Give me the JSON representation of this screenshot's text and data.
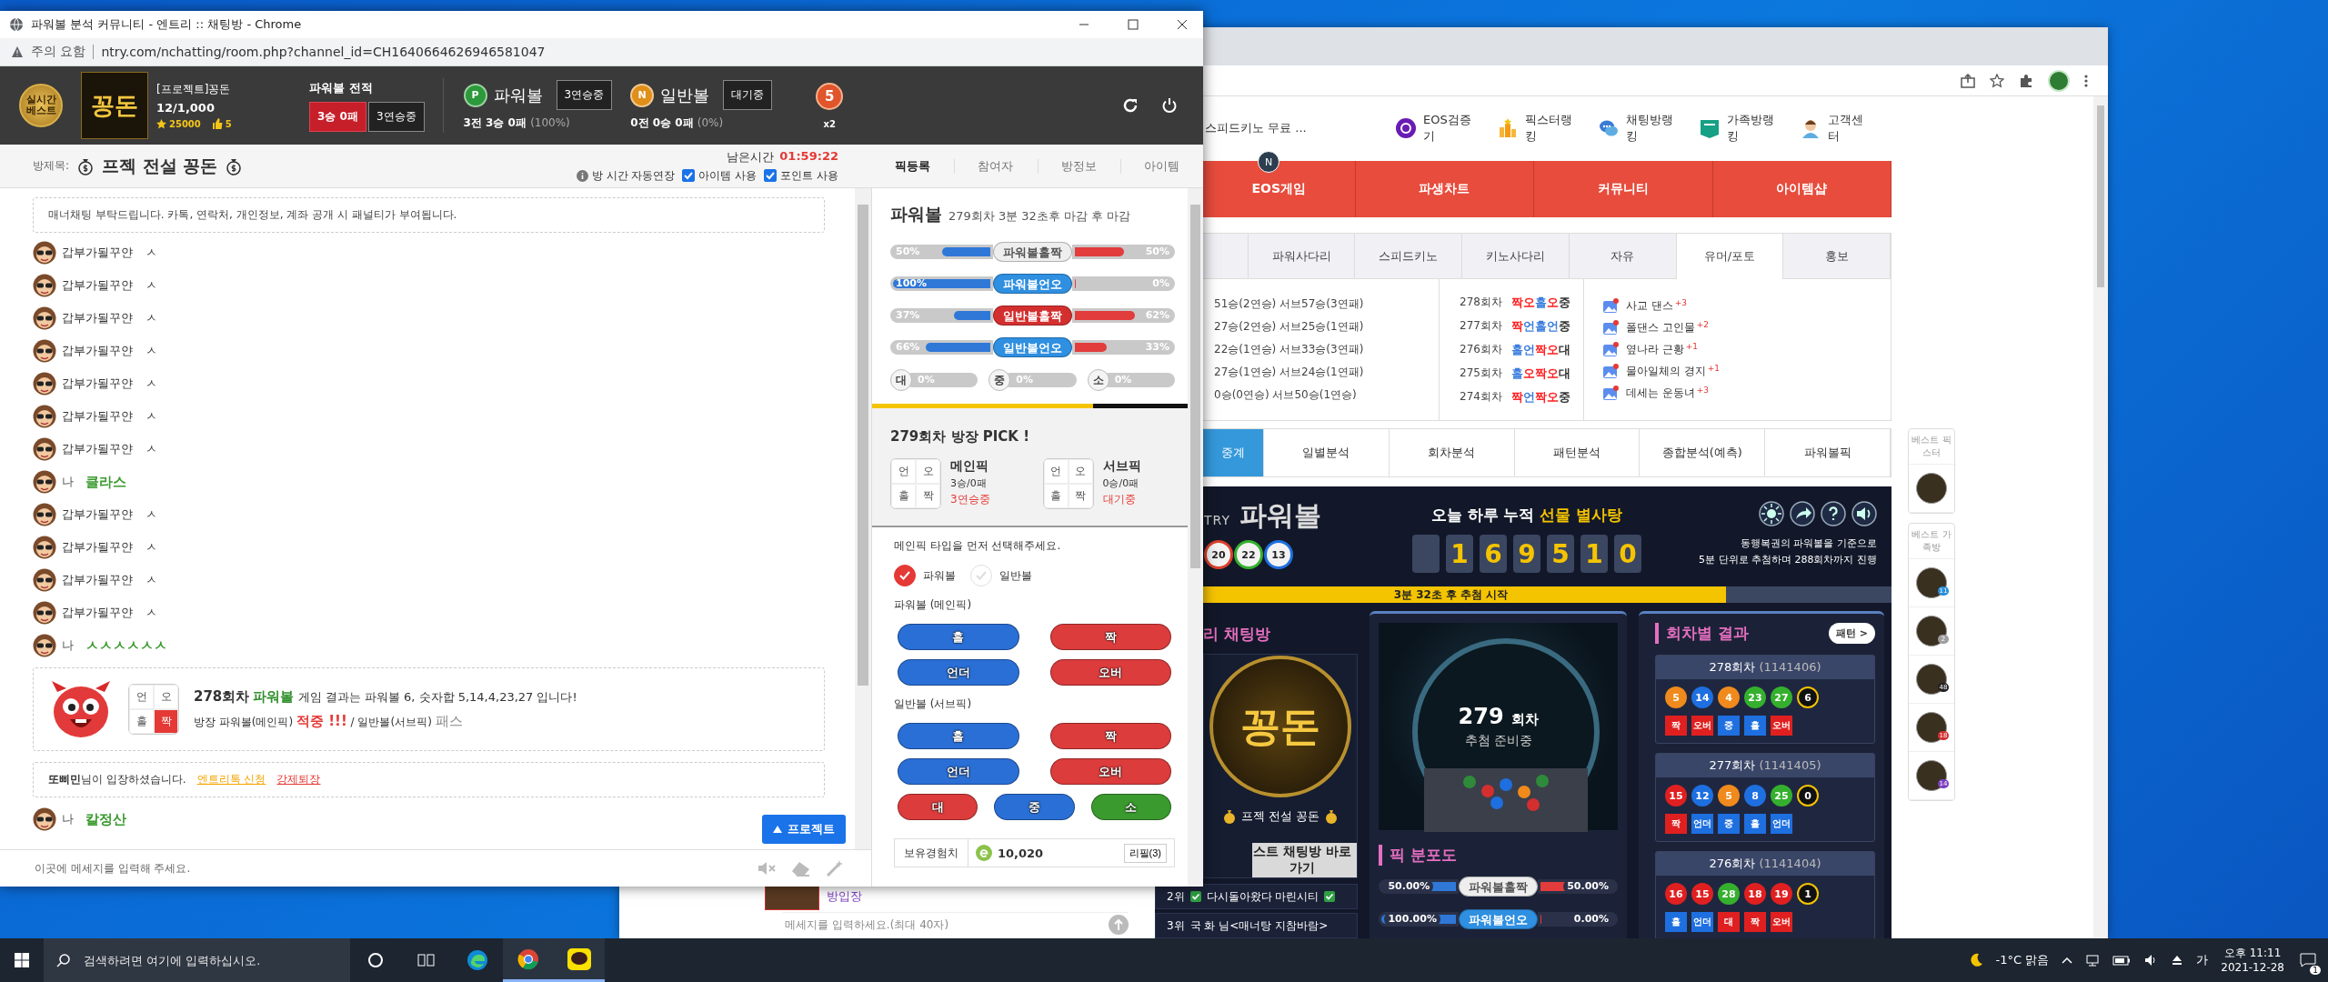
{
  "chat_window": {
    "title": "파워볼 분석 커뮤니티 - 엔트리 :: 채팅방 - Chrome",
    "security_label": "주의 요함",
    "url": "ntry.com/nchatting/room.php?channel_id=CH1640664626946581047",
    "header": {
      "badge": "실시간 베스트",
      "logo": "꽁돈",
      "room_name": "[프로젝트]꽁돈",
      "members": "12/1,000",
      "points": "25000",
      "likes": "5",
      "record_title": "파워볼 전적",
      "record": "3승 0패",
      "record_streak": "3연승중",
      "games": [
        {
          "badge": "P",
          "name": "파워볼",
          "status": "3연승중",
          "stats": "3전 3승 0패",
          "rate": "(100%)"
        },
        {
          "badge": "N",
          "name": "일반볼",
          "status": "대기중",
          "stats": "0전 0승 0패",
          "rate": "(0%)"
        }
      ],
      "medal": "5",
      "multiplier": "x2"
    },
    "room": {
      "label": "방제목:",
      "title": "프젝 전설 꽁돈",
      "time_label": "남은시간",
      "time": "01:59:22",
      "auto_extend": "방 시간 자동연장",
      "options": [
        {
          "label": "아이템 사용",
          "checked": true
        },
        {
          "label": "포인트 사용",
          "checked": true
        }
      ],
      "tabs": [
        {
          "label": "픽등록",
          "selected": true
        },
        {
          "label": "참여자",
          "selected": false
        },
        {
          "label": "방정보",
          "selected": false
        },
        {
          "label": "아이템",
          "selected": false
        }
      ]
    },
    "chat": {
      "notice": "매너채팅 부탁드립니다. 카톡, 연락처, 개인정보, 계좌 공개 시 패널티가 부여됩니다.",
      "messages": [
        {
          "kind": "user",
          "name": "갑부가될꾸얀",
          "text": "ㅅ"
        },
        {
          "kind": "user",
          "name": "갑부가될꾸얀",
          "text": "ㅅ"
        },
        {
          "kind": "user",
          "name": "갑부가될꾸얀",
          "text": "ㅅ"
        },
        {
          "kind": "user",
          "name": "갑부가될꾸얀",
          "text": "ㅅ"
        },
        {
          "kind": "user",
          "name": "갑부가될꾸얀",
          "text": "ㅅ"
        },
        {
          "kind": "user",
          "name": "갑부가될꾸얀",
          "text": "ㅅ"
        },
        {
          "kind": "user",
          "name": "갑부가될꾸얀",
          "text": "ㅅ"
        },
        {
          "kind": "me",
          "name": "나",
          "text": "클라스"
        },
        {
          "kind": "user",
          "name": "갑부가될꾸얀",
          "text": "ㅅ"
        },
        {
          "kind": "user",
          "name": "갑부가될꾸얀",
          "text": "ㅅ"
        },
        {
          "kind": "user",
          "name": "갑부가될꾸얀",
          "text": "ㅅ"
        },
        {
          "kind": "user",
          "name": "갑부가될꾸얀",
          "text": "ㅅ"
        },
        {
          "kind": "me",
          "name": "나",
          "text": "ㅅㅅㅅㅅㅅㅅ"
        },
        {
          "kind": "result",
          "round": "278회차",
          "game": "파워볼",
          "text": "게임 결과는 파워볼 6, 숫자합 5,14,4,23,27 입니다!",
          "cells": [
            {
              "label": "언",
              "selected": false
            },
            {
              "label": "오",
              "selected": false
            },
            {
              "label": "홀",
              "selected": false
            },
            {
              "label": "짝",
              "selected": true
            }
          ],
          "verdict": [
            {
              "kind": "plain",
              "text": "방장 파워볼(메인픽)"
            },
            {
              "kind": "hit",
              "text": "적중 !!!"
            },
            {
              "kind": "plain",
              "text": "/ 일반볼(서브픽)"
            },
            {
              "kind": "pass",
              "text": "패스"
            }
          ]
        },
        {
          "kind": "system",
          "user": "또삐민",
          "text": "님이 입장하셨습니다.",
          "links": [
            {
              "label": "엔트리톡 신청",
              "color": "#f5a300"
            },
            {
              "label": "강제퇴장",
              "color": "#e53935"
            }
          ]
        },
        {
          "kind": "me",
          "name": "나",
          "text": "칼정산"
        }
      ],
      "float_button": "프로젝트",
      "input": {
        "placeholder": "이곳에 메세지를 입력해 주세요."
      }
    },
    "pick_panel": {
      "game": "파워볼",
      "round_info": "279회차 3분 32초후 마감 후 마감",
      "bars": [
        {
          "label": "파워볼홀짝",
          "color": "#eeeeee",
          "left": {
            "text": "50%",
            "level": 0.5
          },
          "right": {
            "text": "50%",
            "level": 0.5
          }
        },
        {
          "label": "파워볼언오",
          "color": "#2f8fe0",
          "left": {
            "text": "100%",
            "level": 1
          },
          "right": {
            "text": "0%",
            "level": 0
          }
        },
        {
          "label": "일반볼홀짝",
          "color": "#d32f2f",
          "left": {
            "text": "37%",
            "level": 0.37
          },
          "right": {
            "text": "62%",
            "level": 0.62
          }
        },
        {
          "label": "일반볼언오",
          "color": "#2f8fe0",
          "left": {
            "text": "66%",
            "level": 0.66
          },
          "right": {
            "text": "33%",
            "level": 0.33
          }
        }
      ],
      "size_bars": [
        {
          "label": "대",
          "text": "0%",
          "level": 0
        },
        {
          "label": "중",
          "text": "0%",
          "level": 0
        },
        {
          "label": "소",
          "text": "0%",
          "level": 0
        }
      ],
      "timer": {
        "level": 0.7
      },
      "pick_title": "279회차 방장 PICK !",
      "picks": [
        {
          "title": "메인픽",
          "record": "3승/0패",
          "status": "3연승중",
          "cells": [
            {
              "label": "언",
              "selected": false
            },
            {
              "label": "오",
              "selected": false
            },
            {
              "label": "홀",
              "selected": false
            },
            {
              "label": "짝",
              "selected": false
            }
          ]
        },
        {
          "title": "서브픽",
          "record": "0승/0패",
          "status": "대기중",
          "cells": [
            {
              "label": "언",
              "selected": false
            },
            {
              "label": "오",
              "selected": false
            },
            {
              "label": "홀",
              "selected": false
            },
            {
              "label": "짝",
              "selected": false
            }
          ]
        }
      ],
      "instruction": "메인픽 타입을 먼저 선택해주세요.",
      "types": [
        {
          "label": "파워볼",
          "selected": true
        },
        {
          "label": "일반볼",
          "selected": false
        }
      ],
      "groups": [
        {
          "title": "파워볼 (메인픽)",
          "buttons": [
            {
              "label": "홀",
              "color": "#2a6fd6"
            },
            {
              "label": "짝",
              "color": "#dc3c3c"
            },
            {
              "label": "언더",
              "color": "#2a6fd6"
            },
            {
              "label": "오버",
              "color": "#dc3c3c"
            }
          ]
        },
        {
          "title": "일반볼 (서브픽)",
          "buttons": [
            {
              "label": "홀",
              "color": "#2a6fd6"
            },
            {
              "label": "짝",
              "color": "#dc3c3c"
            },
            {
              "label": "언더",
              "color": "#2a6fd6"
            },
            {
              "label": "오버",
              "color": "#dc3c3c"
            },
            {
              "label": "대",
              "color": "#dc3c3c"
            },
            {
              "label": "중",
              "color": "#2a6fd6"
            },
            {
              "label": "소",
              "color": "#3a9a2e"
            }
          ]
        }
      ],
      "exp_label": "보유경험치",
      "exp_value": "10,020",
      "refill": "리필(3)"
    }
  },
  "browser": {
    "ticker": "스피드키노 무료 ...",
    "shortcuts": [
      {
        "label": "EOS검증기",
        "kind": "eos"
      },
      {
        "label": "픽스터랭킹",
        "kind": "trophy"
      },
      {
        "label": "채팅방랭킹",
        "kind": "chat"
      },
      {
        "label": "가족방랭킹",
        "kind": "fam"
      },
      {
        "label": "고객센터",
        "kind": "agent"
      }
    ],
    "nav": [
      {
        "label": "EOS게임",
        "badge": "N"
      },
      {
        "label": "파생차트"
      },
      {
        "label": "커뮤니티"
      },
      {
        "label": "아이템샵"
      }
    ],
    "board_tabs": [
      {
        "label": "파워사다리",
        "selected": false
      },
      {
        "label": "스피드키노",
        "selected": false
      },
      {
        "label": "키노사다리",
        "selected": false
      },
      {
        "label": "자유",
        "selected": false
      },
      {
        "label": "유머/포토",
        "selected": true
      },
      {
        "label": "홍보",
        "selected": false
      }
    ],
    "stats": [
      "51승(2연승) 서브57승(3연패)",
      "27승(2연승) 서브25승(1연패)",
      "22승(1연승) 서브33승(3연패)",
      "27승(1연승) 서브24승(1연패)",
      "0승(0연승) 서브50승(1연승)"
    ],
    "results": [
      {
        "round": "278회차",
        "tokens": [
          {
            "text": "짝",
            "color": "#ff2020"
          },
          {
            "text": "오",
            "color": "#ff2020"
          },
          {
            "text": "홀",
            "color": "#3b7ddd"
          },
          {
            "text": "오",
            "color": "#ff2020"
          },
          {
            "text": "중",
            "color": "#333333"
          }
        ]
      },
      {
        "round": "277회차",
        "tokens": [
          {
            "text": "짝",
            "color": "#ff2020"
          },
          {
            "text": "언",
            "color": "#3b7ddd"
          },
          {
            "text": "홀",
            "color": "#3b7ddd"
          },
          {
            "text": "언",
            "color": "#3b7ddd"
          },
          {
            "text": "중",
            "color": "#333333"
          }
        ]
      },
      {
        "round": "276회차",
        "tokens": [
          {
            "text": "홀",
            "color": "#3b7ddd"
          },
          {
            "text": "언",
            "color": "#3b7ddd"
          },
          {
            "text": "짝",
            "color": "#ff2020"
          },
          {
            "text": "오",
            "color": "#ff2020"
          },
          {
            "text": "대",
            "color": "#333333"
          }
        ]
      },
      {
        "round": "275회차",
        "tokens": [
          {
            "text": "홀",
            "color": "#3b7ddd"
          },
          {
            "text": "오",
            "color": "#ff2020"
          },
          {
            "text": "짝",
            "color": "#ff2020"
          },
          {
            "text": "오",
            "color": "#ff2020"
          },
          {
            "text": "대",
            "color": "#333333"
          }
        ]
      },
      {
        "round": "274회차",
        "tokens": [
          {
            "text": "짝",
            "color": "#ff2020"
          },
          {
            "text": "언",
            "color": "#3b7ddd"
          },
          {
            "text": "짝",
            "color": "#ff2020"
          },
          {
            "text": "오",
            "color": "#ff2020"
          },
          {
            "text": "중",
            "color": "#333333"
          }
        ]
      }
    ],
    "posts": [
      {
        "title": "사교 댄스",
        "count": "+3"
      },
      {
        "title": "폴댄스 고인물",
        "count": "+2"
      },
      {
        "title": "옆나라 근황",
        "count": "+1"
      },
      {
        "title": "물아일체의 경지",
        "count": "+1"
      },
      {
        "title": "데세는 운동녀",
        "count": "+3"
      }
    ],
    "analysis_tabs": [
      {
        "label": "중계",
        "selected": true
      },
      {
        "label": "일별분석",
        "selected": false
      },
      {
        "label": "회차분석",
        "selected": false
      },
      {
        "label": "패턴분석",
        "selected": false
      },
      {
        "label": "종합분석(예측)",
        "selected": false
      },
      {
        "label": "파워볼픽",
        "selected": false
      }
    ],
    "side": {
      "pixter_title": "베스트 픽스터",
      "family_title": "베스트 가족방",
      "family": [
        {
          "badge": "11",
          "color": "#2a8fd8"
        },
        {
          "badge": "2",
          "color": "#9e9e9e"
        },
        {
          "badge": "48",
          "color": "#222222"
        },
        {
          "badge": "18",
          "color": "#d32f2f"
        },
        {
          "badge": "14",
          "color": "#7b3fbf"
        }
      ]
    },
    "bottom": {
      "entry_label": "방입장",
      "input_placeholder": "메세지를 입력하세요.(최대 40자)"
    },
    "game": {
      "logo_prefix": "TRY",
      "logo": "파워볼",
      "logo_balls": [
        "20",
        "22",
        "13"
      ],
      "headline": "오늘 하루 누적",
      "headline_highlight": "선물 별사탕",
      "counter": [
        "1",
        "6",
        "9",
        "5",
        "1",
        "0"
      ],
      "info": [
        "동행복권의 파워볼을 기준으로",
        "5분 단위로 추첨하며 288회차까지 진행"
      ],
      "countdown": {
        "text": "3분 32초 후 추첨 시작",
        "level": 0.76
      },
      "chat_title": "리 채팅방",
      "chat_logo": "꽁돈",
      "chat_name": "프젝 전설 꽁돈",
      "best_button": "스트 채팅방 바로가기",
      "ranking": [
        {
          "rank": "2위",
          "name": "다시돌아왔다 마린시티"
        },
        {
          "rank": "3위",
          "name": "국 화 님<매너탕 지참바람>"
        }
      ],
      "machine": {
        "round": "279",
        "round_label": "회차",
        "status": "추첨 준비중"
      },
      "distribution_title": "픽 분포도",
      "distribution": [
        {
          "label": "파워볼홀짝",
          "color": "#eeeeee",
          "left": {
            "text": "50.00%",
            "level": 0.5
          },
          "right": {
            "text": "50.00%",
            "level": 0.5
          }
        },
        {
          "label": "파워볼언오",
          "color": "#2f8fe0",
          "left": {
            "text": "100.00%",
            "level": 1
          },
          "right": {
            "text": "0.00%",
            "level": 0
          }
        }
      ],
      "results_title": "회차별 결과",
      "pattern_button": "패턴 >",
      "rounds": [
        {
          "round": "278회차",
          "id": "(1141406)",
          "balls": [
            {
              "n": "5",
              "color": "#f08a1c"
            },
            {
              "n": "14",
              "color": "#1e6fe0"
            },
            {
              "n": "4",
              "color": "#f08a1c"
            },
            {
              "n": "23",
              "color": "#35b02e"
            },
            {
              "n": "27",
              "color": "#35b02e"
            }
          ],
          "power": "6",
          "tags": [
            {
              "label": "짝",
              "color": "#e02020"
            },
            {
              "label": "오버",
              "color": "#e02020"
            },
            {
              "label": "중",
              "color": "#1e6fe0"
            },
            {
              "label": "홀",
              "color": "#1e6fe0"
            },
            {
              "label": "오버",
              "color": "#e02020"
            }
          ]
        },
        {
          "round": "277회차",
          "id": "(1141405)",
          "balls": [
            {
              "n": "15",
              "color": "#e02020"
            },
            {
              "n": "12",
              "color": "#1e6fe0"
            },
            {
              "n": "5",
              "color": "#f08a1c"
            },
            {
              "n": "8",
              "color": "#1e6fe0"
            },
            {
              "n": "25",
              "color": "#35b02e"
            }
          ],
          "power": "0",
          "tags": [
            {
              "label": "짝",
              "color": "#e02020"
            },
            {
              "label": "언더",
              "color": "#1e6fe0"
            },
            {
              "label": "중",
              "color": "#1e6fe0"
            },
            {
              "label": "홀",
              "color": "#1e6fe0"
            },
            {
              "label": "언더",
              "color": "#1e6fe0"
            }
          ]
        },
        {
          "round": "276회차",
          "id": "(1141404)",
          "balls": [
            {
              "n": "16",
              "color": "#e02020"
            },
            {
              "n": "15",
              "color": "#e02020"
            },
            {
              "n": "28",
              "color": "#35b02e"
            },
            {
              "n": "18",
              "color": "#e02020"
            },
            {
              "n": "19",
              "color": "#e02020"
            }
          ],
          "power": "1",
          "tags": [
            {
              "label": "홀",
              "color": "#1e6fe0"
            },
            {
              "label": "언더",
              "color": "#1e6fe0"
            },
            {
              "label": "대",
              "color": "#e02020"
            },
            {
              "label": "짝",
              "color": "#e02020"
            },
            {
              "label": "오버",
              "color": "#e02020"
            }
          ]
        }
      ]
    }
  },
  "taskbar": {
    "search_placeholder": "검색하려면 여기에 입력하십시오.",
    "weather": "-1°C 맑음",
    "ime": "가",
    "time": "오후 11:11",
    "date": "2021-12-28",
    "notifications": "1"
  }
}
